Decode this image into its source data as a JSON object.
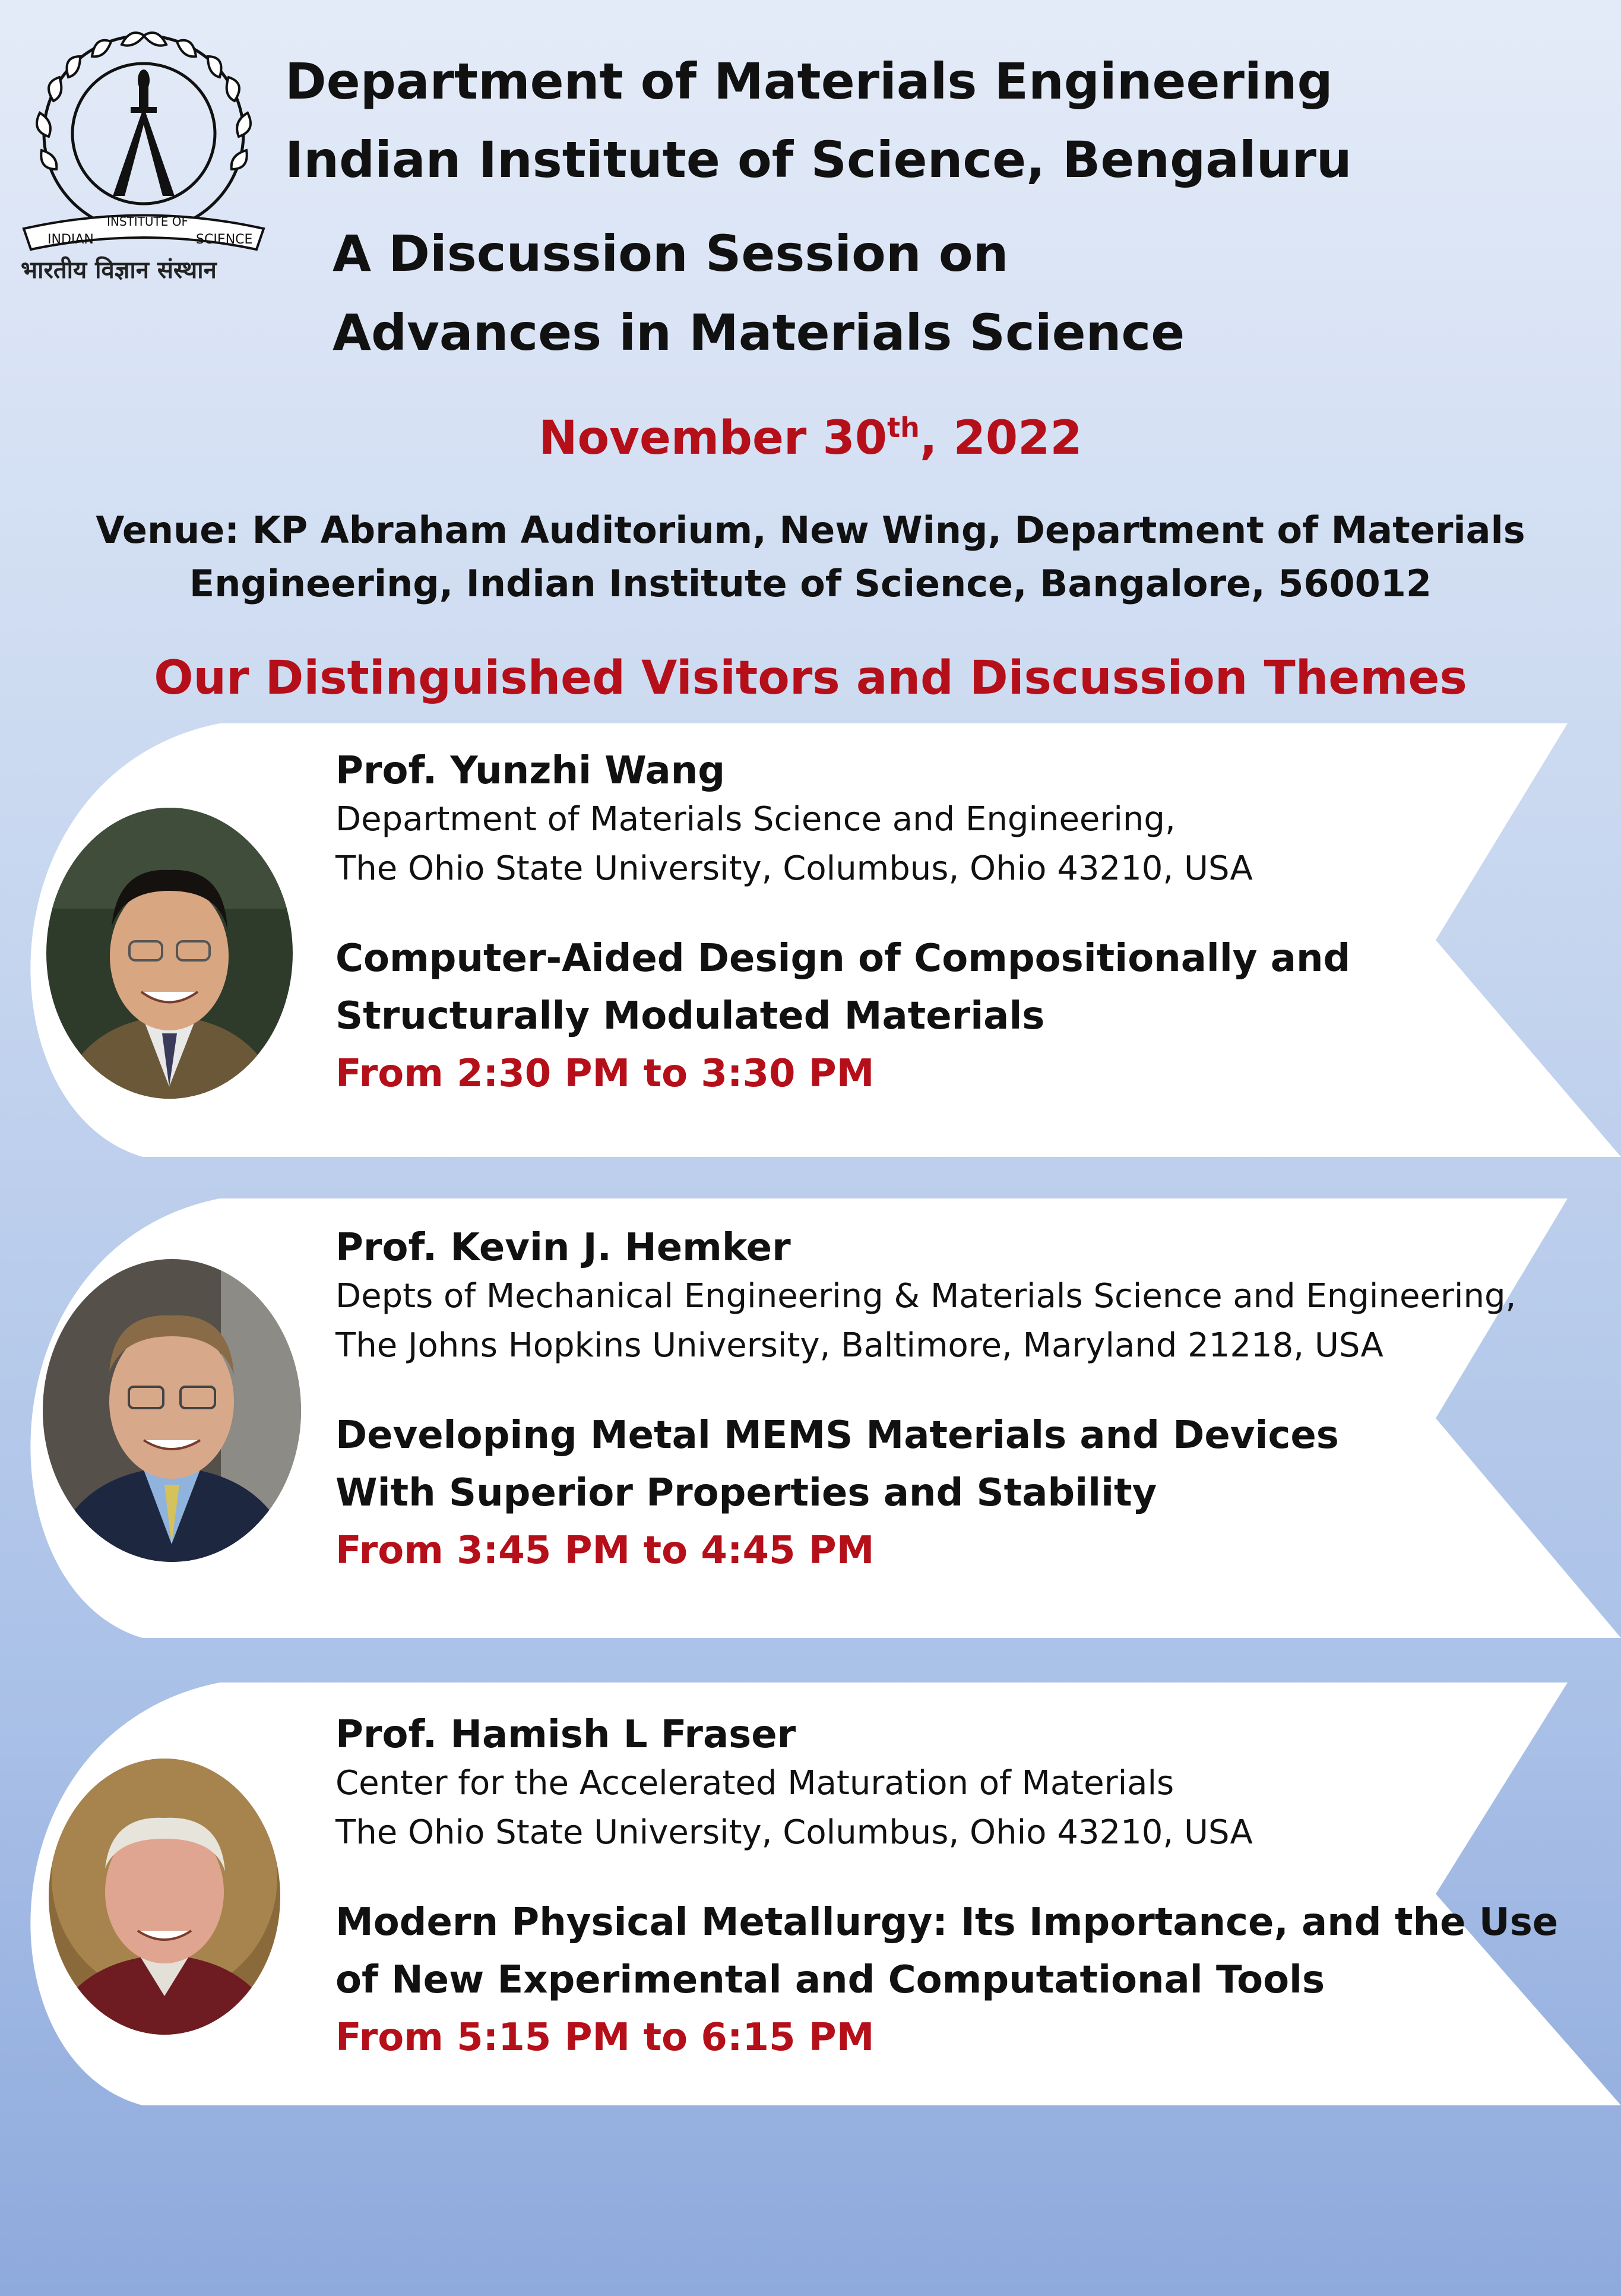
{
  "header": {
    "hindi_logo_text": "भारतीय विज्ञान संस्थान",
    "logo_ring_text": [
      "INDIAN",
      "INSTITUTE OF",
      "SCIENCE"
    ],
    "department": "Department of Materials Engineering",
    "institute": "Indian Institute of Science, Bengaluru",
    "session_line1": "A Discussion Session on",
    "session_line2": "Advances in Materials Science",
    "date_prefix": "November 30",
    "date_sup": "th",
    "date_suffix": ", 2022",
    "venue_line1": "Venue: KP Abraham Auditorium, New Wing, Department of Materials",
    "venue_line2": "Engineering,  Indian Institute of Science, Bangalore, 560012",
    "themes_heading": "Our Distinguished Visitors and Discussion Themes"
  },
  "speakers": [
    {
      "name": "Prof. Yunzhi Wang",
      "affiliation_line1": "Department of Materials Science and Engineering,",
      "affiliation_line2": "The Ohio State University, Columbus, Ohio 43210, USA",
      "talk_line1": "Computer-Aided Design of Compositionally and",
      "talk_line2": "Structurally Modulated Materials",
      "time": "From 2:30 PM to 3:30 PM"
    },
    {
      "name": "Prof. Kevin J. Hemker",
      "affiliation_line1": "Depts of Mechanical Engineering & Materials Science and Engineering,",
      "affiliation_line2": "The Johns Hopkins University, Baltimore, Maryland 21218, USA",
      "talk_line1": "Developing Metal MEMS Materials and Devices",
      "talk_line2": "With Superior Properties and Stability",
      "time": "From 3:45 PM to 4:45 PM"
    },
    {
      "name": "Prof. Hamish L Fraser",
      "affiliation_line1": "Center for the Accelerated Maturation of Materials",
      "affiliation_line2": "The Ohio State University, Columbus, Ohio  43210, USA",
      "talk_line1": "Modern Physical Metallurgy: Its Importance, and the Use",
      "talk_line2": "of New Experimental and Computational Tools",
      "time": "From 5:15 PM to 6:15 PM"
    }
  ],
  "colors": {
    "accent_red": "#b50f1a",
    "banner": "#ffffff",
    "background": "#a9c0e7"
  }
}
